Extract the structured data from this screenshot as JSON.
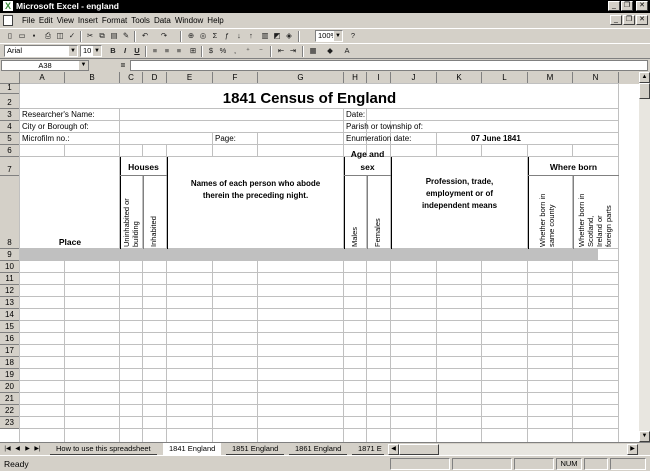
{
  "window": {
    "title": "Microsoft Excel - england"
  },
  "menu": [
    "File",
    "Edit",
    "View",
    "Insert",
    "Format",
    "Tools",
    "Data",
    "Window",
    "Help"
  ],
  "toolbar": {
    "zoom": "100%",
    "font": "Arial",
    "font_size": "10"
  },
  "formula_bar": {
    "cell_ref": "A38",
    "equals_label": "="
  },
  "columns": [
    "A",
    "B",
    "C",
    "D",
    "E",
    "F",
    "G",
    "H",
    "I",
    "J",
    "K",
    "L",
    "M",
    "N"
  ],
  "rows": [
    "1",
    "2",
    "3",
    "4",
    "5",
    "6",
    "7",
    "8",
    "9",
    "10",
    "11",
    "12",
    "13",
    "14",
    "15",
    "16",
    "17",
    "18",
    "19",
    "20",
    "21",
    "22",
    "23"
  ],
  "form": {
    "title": "1841 Census of England",
    "researcher_label": "Researcher's Name:",
    "date_label": "Date:",
    "city_label": "City or Borough of:",
    "parish_label": "Parish or township of:",
    "microfilm_label": "Microfilm no.:",
    "page_label": "Page:",
    "enum_label": "Enumeration date:",
    "enum_value": "07 June 1841",
    "houses": "Houses",
    "uninhabited": "Uninhabited or building",
    "inhabited": "Inhabited",
    "names_line1": "Names of each person who abode",
    "names_line2": "therein the preceding night.",
    "age_line1": "Age and",
    "age_line2": "sex",
    "males": "Males",
    "females": "Females",
    "prof_line1": "Profession, trade,",
    "prof_line2": "employment or of",
    "prof_line3": "independent means",
    "where_born": "Where born",
    "same_county_1": "Whether born in",
    "same_county_2": "same county",
    "scotland_1": "Whether born in",
    "scotland_2": "Scotland,",
    "scotland_3": "Ireland or",
    "scotland_4": "foreign parts",
    "place": "Place"
  },
  "sheet_tabs": [
    "How to use this spreadsheet",
    "1841 England",
    "1851 England",
    "1861 England",
    "1871 E"
  ],
  "active_tab": "1841 England",
  "status": {
    "text": "Ready",
    "num": "NUM"
  },
  "colors": {
    "row9_fill": "#c0c0c0",
    "titlebar": "#000000"
  }
}
